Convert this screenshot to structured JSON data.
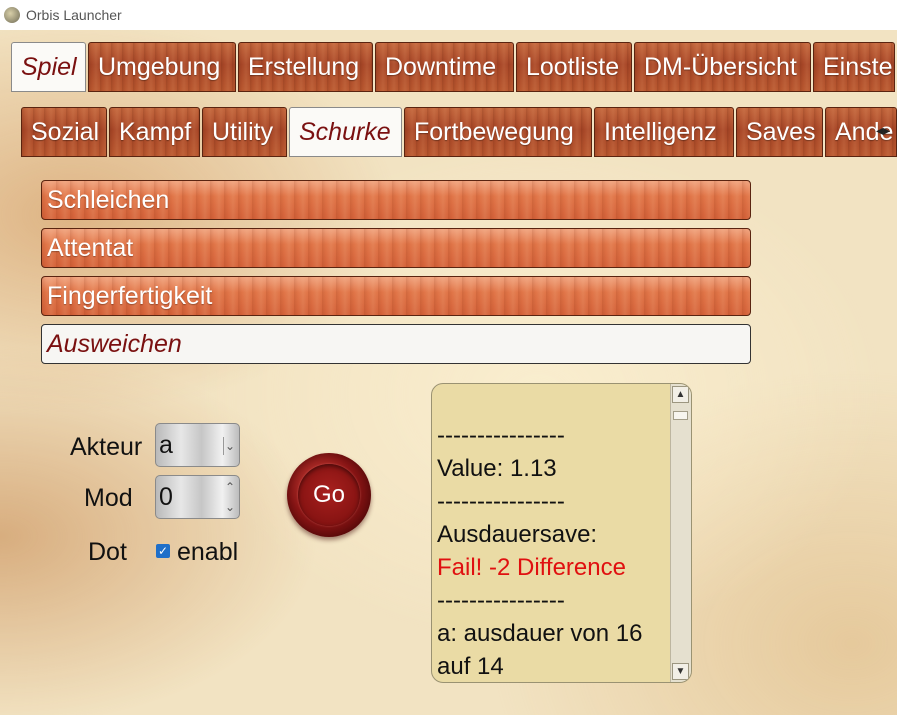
{
  "window": {
    "title": "Orbis Launcher",
    "icon": "app-icon"
  },
  "main_tabs": [
    {
      "label": "Spiel",
      "active": true
    },
    {
      "label": "Umgebung"
    },
    {
      "label": "Erstellung"
    },
    {
      "label": "Downtime"
    },
    {
      "label": "Lootliste"
    },
    {
      "label": "DM-Übersicht"
    },
    {
      "label": "Einstel"
    }
  ],
  "sub_tabs": [
    {
      "label": "Sozial"
    },
    {
      "label": "Kampf"
    },
    {
      "label": "Utility"
    },
    {
      "label": "Schurke",
      "active": true
    },
    {
      "label": "Fortbewegung"
    },
    {
      "label": "Intelligenz"
    },
    {
      "label": "Saves"
    },
    {
      "label": "Ande"
    }
  ],
  "topics": [
    {
      "label": "Schleichen"
    },
    {
      "label": "Attentat"
    },
    {
      "label": "Fingerfertigkeit"
    },
    {
      "label": "Ausweichen",
      "active": true
    }
  ],
  "form": {
    "akteur_label": "Akteur",
    "akteur_value": "a",
    "mod_label": "Mod",
    "mod_value": "0",
    "dot_label": "Dot",
    "dot_checkbox_label": "enabl",
    "dot_checked": true
  },
  "go_button": {
    "label": "Go"
  },
  "log": {
    "lines": [
      "----------------",
      "Value: 1.13",
      "----------------",
      "Ausdauersave:",
      "Fail! -2 Difference",
      "----------------",
      "a: ausdauer von 16 auf 14"
    ]
  },
  "colors": {
    "accent_active_text": "#7a1010",
    "fail_text": "#e01010",
    "seal": "#8e1616"
  }
}
